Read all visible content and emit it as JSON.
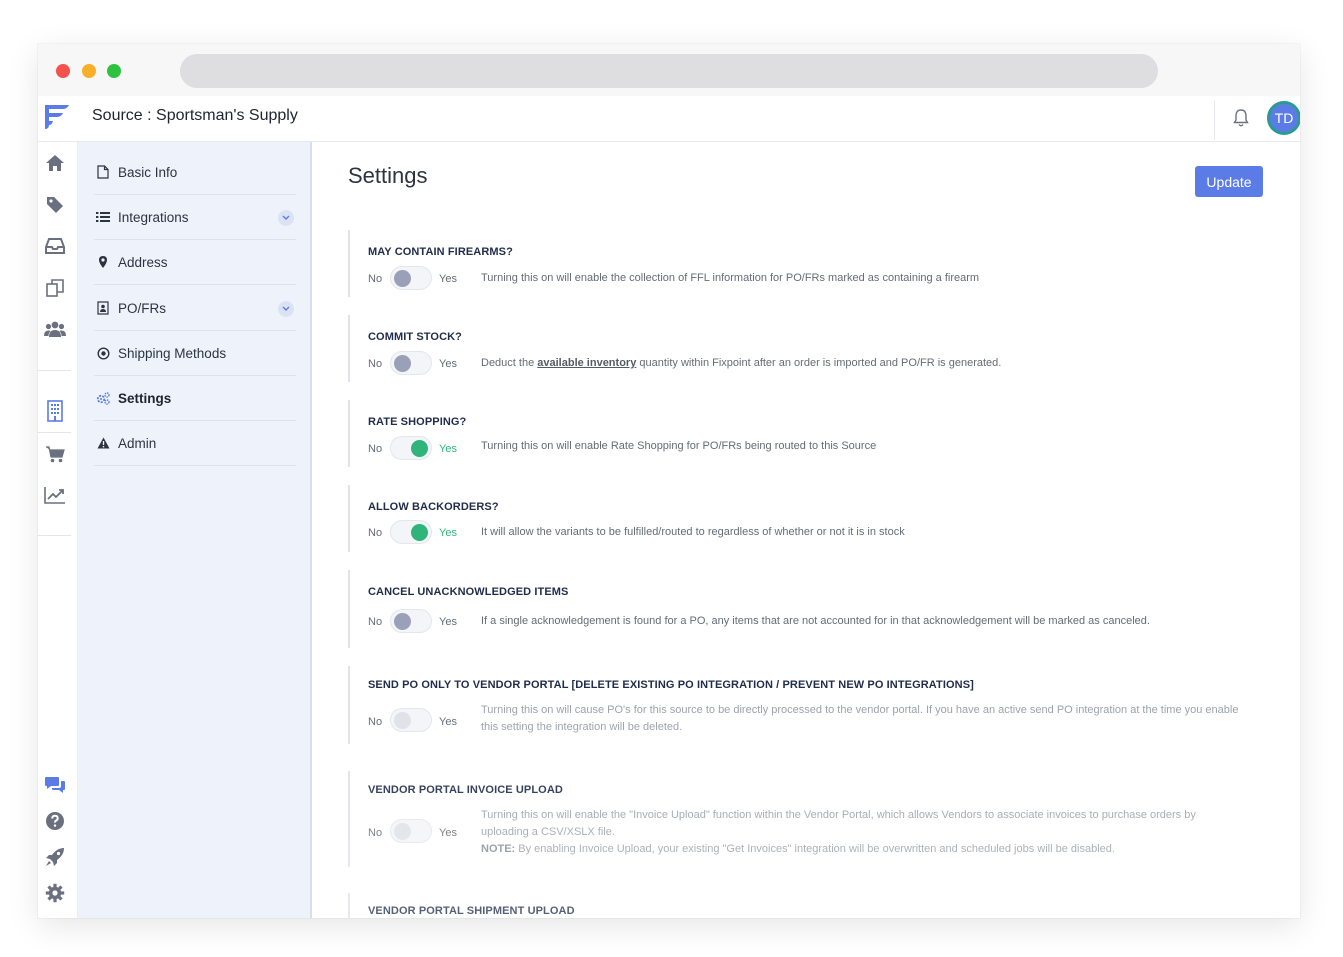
{
  "header": {
    "source_label": "Source :",
    "source_name": "Sportsman's Supply",
    "avatar_initials": "TD"
  },
  "sidebar_icons": [
    "home-icon",
    "tag-icon",
    "inbox-icon",
    "copy-icon",
    "users-icon",
    "building-icon",
    "cart-icon",
    "chart-line-icon",
    "chat-icon",
    "help-icon",
    "rocket-icon",
    "gear-icon"
  ],
  "subnav": {
    "items": [
      {
        "label": "Basic Info",
        "icon": "file-icon"
      },
      {
        "label": "Integrations",
        "icon": "list-icon"
      },
      {
        "label": "Address",
        "icon": "map-pin-icon"
      },
      {
        "label": "PO/FRs",
        "icon": "contact-card-icon"
      },
      {
        "label": "Shipping Methods",
        "icon": "target-icon"
      },
      {
        "label": "Settings",
        "icon": "cogs-icon"
      },
      {
        "label": "Admin",
        "icon": "warning-icon"
      }
    ]
  },
  "main": {
    "title": "Settings",
    "update_label": "Update",
    "no_label": "No",
    "yes_label": "Yes",
    "settings": [
      {
        "title": "MAY CONTAIN FIREARMS?",
        "state": "off",
        "desc": "Turning this on will enable the collection of FFL information for PO/FRs marked as containing a firearm"
      },
      {
        "title": "COMMIT STOCK?",
        "state": "off",
        "desc_pre": "Deduct the ",
        "desc_link": "available inventory",
        "desc_post": " quantity within Fixpoint after an order is imported and PO/FR is generated."
      },
      {
        "title": "RATE SHOPPING?",
        "state": "on",
        "desc": "Turning this on will enable Rate Shopping for PO/FRs being routed to this Source"
      },
      {
        "title": "ALLOW BACKORDERS?",
        "state": "on",
        "desc": "It will allow the variants to be fulfilled/routed to regardless of whether or not it is in stock"
      },
      {
        "title": "CANCEL UNACKNOWLEDGED ITEMS",
        "state": "off",
        "desc": "If a single acknowledgement is found for a PO, any items that are not accounted for in that acknowledgement will be marked as canceled."
      },
      {
        "title": "SEND PO ONLY TO VENDOR PORTAL [DELETE EXISTING PO INTEGRATION / PREVENT NEW PO INTEGRATIONS]",
        "state": "disabled",
        "desc": "Turning this on will cause PO's for this source to be directly processed to the vendor portal. If you have an active send PO integration at the time you enable this setting the integration will be deleted."
      },
      {
        "title": "VENDOR PORTAL INVOICE UPLOAD",
        "state": "disabled",
        "desc": "Turning this on will enable the \"Invoice Upload\" function within the Vendor Portal, which allows Vendors to associate invoices to purchase orders by uploading a CSV/XSLX file.",
        "note_label": "NOTE:",
        "note": " By enabling Invoice Upload, your existing \"Get Invoices\" integration will be overwritten and scheduled jobs will be disabled."
      },
      {
        "title": "VENDOR PORTAL SHIPMENT UPLOAD"
      }
    ]
  },
  "colors": {
    "accent": "#5b7ce6",
    "toggle_on": "#2fb57a",
    "subnav_bg": "#eef2fb"
  }
}
